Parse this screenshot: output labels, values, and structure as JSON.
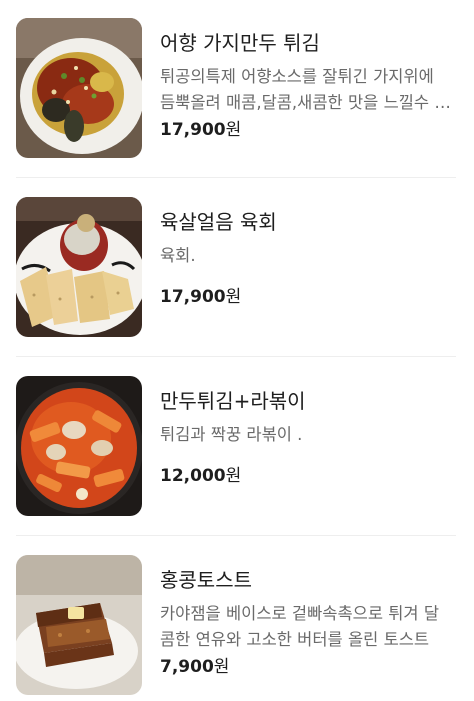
{
  "menu": {
    "items": [
      {
        "name": "어향 가지만두 튀김",
        "description": "튀공의특제 어향소스를 잘튀긴 가지위에 듬뿍올려 매콤,달콤,새콤한 맛을 느낄수 있는 메뉴",
        "price": "17,900",
        "photo_icon": "eggplant-dumpling-dish-photo"
      },
      {
        "name": "육살얼음 육회",
        "description": "육회.",
        "price": "17,900",
        "photo_icon": "beef-tartare-dish-photo"
      },
      {
        "name": "만두튀김+라볶이",
        "description": "튀김과 짝꿍 라볶이 .",
        "price": "12,000",
        "photo_icon": "rabokki-dish-photo"
      },
      {
        "name": "홍콩토스트",
        "description": "카야잼을 베이스로 겉빠속촉으로 튀겨 달콤한 연유와 고소한 버터를 올린 토스트",
        "price": "7,900",
        "photo_icon": "hongkong-toast-dish-photo"
      }
    ],
    "currency_suffix": "원"
  }
}
